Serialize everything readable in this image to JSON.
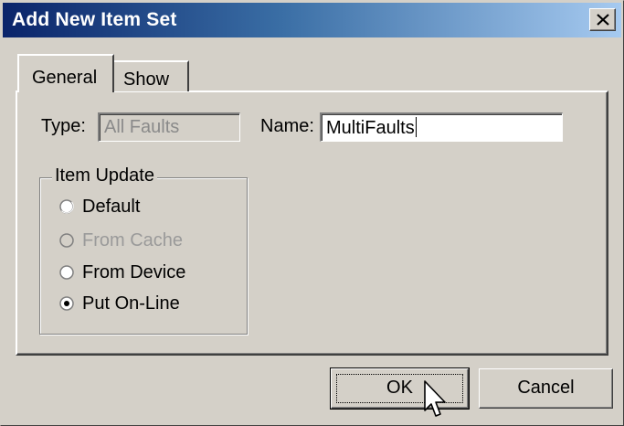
{
  "window": {
    "title": "Add New Item Set"
  },
  "tabs": [
    {
      "label": "General",
      "selected": true
    },
    {
      "label": "Show",
      "selected": false
    }
  ],
  "general": {
    "type_label": "Type:",
    "type_value": "All Faults",
    "name_label": "Name:",
    "name_value": "MultiFaults"
  },
  "item_update": {
    "legend": "Item Update",
    "options": [
      {
        "label": "Default",
        "checked": false,
        "disabled": false
      },
      {
        "label": "From Cache",
        "checked": false,
        "disabled": true
      },
      {
        "label": "From Device",
        "checked": false,
        "disabled": false
      },
      {
        "label": "Put On-Line",
        "checked": true,
        "disabled": false
      }
    ]
  },
  "buttons": {
    "ok": "OK",
    "cancel": "Cancel"
  },
  "icons": {
    "close": "close-icon",
    "cursor": "mouse-pointer-icon"
  }
}
